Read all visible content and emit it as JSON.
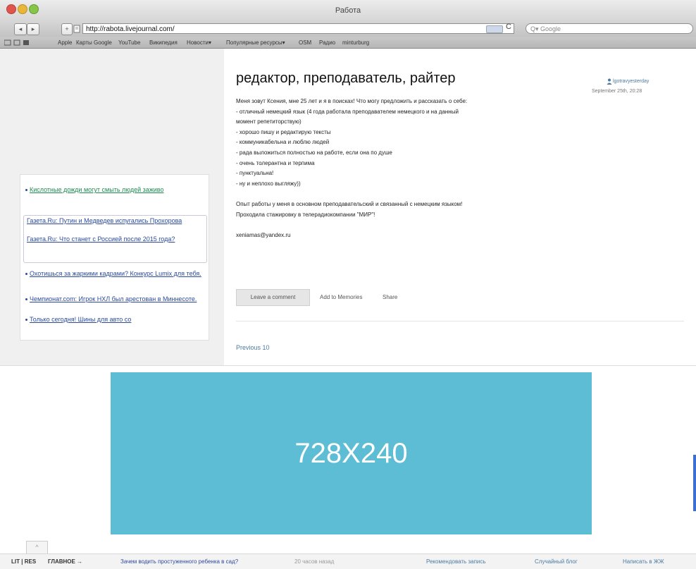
{
  "window": {
    "title": "Работа"
  },
  "toolbar": {
    "back": "◂",
    "forward": "▸",
    "add": "+",
    "url": "http://rabota.livejournal.com/",
    "reload": "C",
    "search_placeholder": "Q▾ Google"
  },
  "bookmarks": [
    "Apple",
    "Карты Google",
    "YouTube",
    "Википедия",
    "Новости▾",
    "Популярные ресурсы▾",
    "OSM",
    "Радио",
    "minturburg"
  ],
  "post": {
    "title": "редактор, преподаватель, райтер",
    "author": "lgotravyesterday",
    "date": "September 25th, 20:28",
    "lines": [
      "Меня зовут Ксения, мне 25 лет и я в поисках! Что могу предложить и рассказать о себе:",
      "- отличный немецкий язык (4 года работала преподавателем немецкого и на данный",
      "момент репетиторствую)",
      "- хорошо пишу и редактирую тексты",
      "- коммуникабельна и люблю людей",
      "- рада выложиться полностью на работе, если она по душе",
      "- очень толерантна и терпима",
      "- пунктуальна!",
      "- ну и неплохо выгляжу))",
      "",
      "Опыт работы у меня в основном преподавательский и связанный с немецким языком!",
      "Проходила стажировку в телерадиокомпании \"МИР\"!",
      "",
      "xeniamas@yandex.ru"
    ],
    "leave_comment": "Leave a comment",
    "add_memories": "Add to Memories",
    "share": "Share",
    "previous": "Previous 10"
  },
  "left_links": {
    "green": "Кислотные дожди могут смыть людей заживо",
    "box1": "Газета.Ru: Путин и Медведев испугались Прохорова",
    "box2": "Газета.Ru: Что станет с Россией после 2015 года?",
    "l1": "Охотишься за жаркими кадрами? Конкурс Lumix для тебя.",
    "l2": "Чемпионат.com: Игрок НХЛ был арестован в Миннесоте.",
    "l3": "Только сегодня! Шины для авто со"
  },
  "ad": {
    "label": "728X240"
  },
  "footer": {
    "logo": "LIT❘RES",
    "main_label": "ГЛАВНОЕ →",
    "headline": "Зачем водить простуженного ребенка в сад?",
    "time": "20 часов назад",
    "recommend": "Рекомендовать запись",
    "random": "Случайный блог",
    "write": "Написать в ЖЖ",
    "tab": "^"
  }
}
